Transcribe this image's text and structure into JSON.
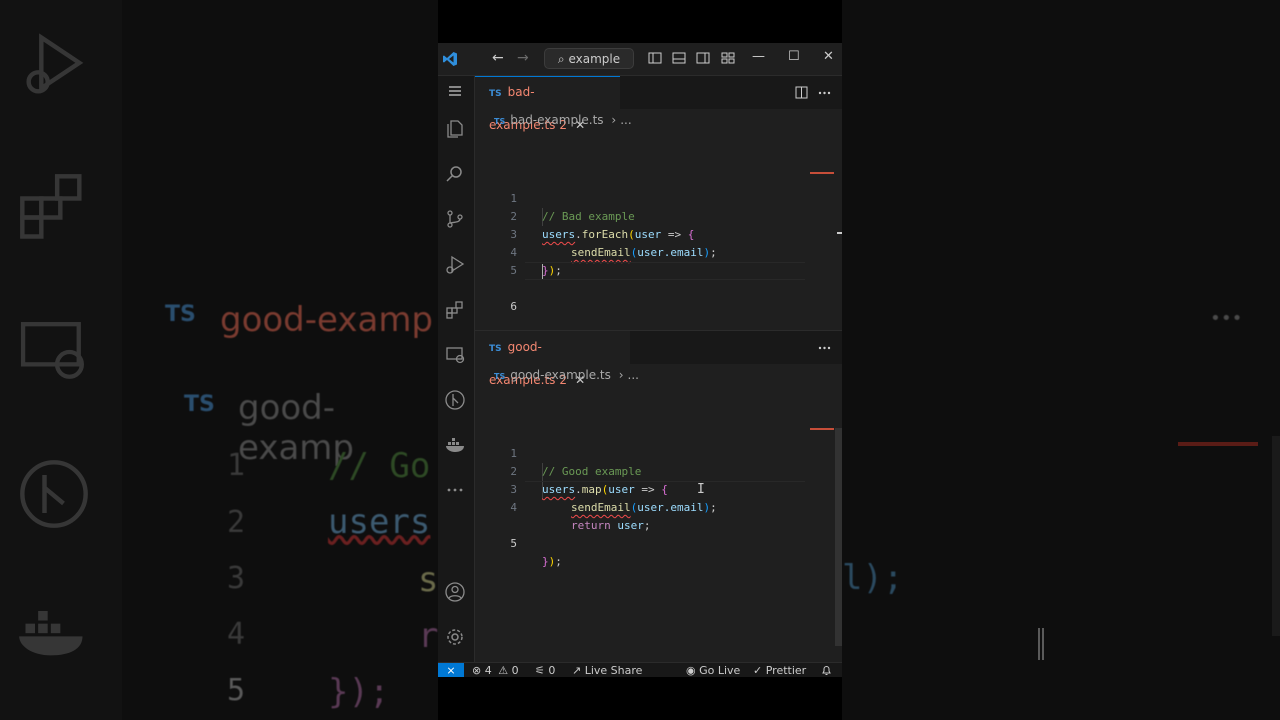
{
  "window": {
    "search_label": "example",
    "nav_back": "←",
    "nav_forward": "→",
    "min": "—",
    "max": "☐",
    "close": "✕"
  },
  "activity_icons": [
    "menu-icon",
    "explorer-icon",
    "search-icon",
    "source-control-icon",
    "run-debug-icon",
    "extensions-icon",
    "remote-explorer-icon",
    "git-graph-icon",
    "docker-icon",
    "more-icon",
    "accounts-icon",
    "settings-gear-icon"
  ],
  "editors": [
    {
      "tab_badge": "TS",
      "tab_filename": "bad-example.ts",
      "tab_problem_count": "2",
      "tab_close": "✕",
      "breadcrumb_file": "bad-example.ts",
      "breadcrumb_sep": "›",
      "breadcrumb_more": "...",
      "lines": [
        {
          "num": "1",
          "text": "// Bad example"
        },
        {
          "num": "2",
          "text": "users.forEach(user => {"
        },
        {
          "num": "3",
          "text": "    sendEmail(user.email);"
        },
        {
          "num": "4",
          "text": "});"
        },
        {
          "num": "5",
          "text": ""
        },
        {
          "num": "6",
          "text": ""
        }
      ],
      "active_line": "6"
    },
    {
      "tab_badge": "TS",
      "tab_filename": "good-example.ts",
      "tab_problem_count": "2",
      "tab_close": "✕",
      "breadcrumb_file": "good-example.ts",
      "breadcrumb_sep": "›",
      "breadcrumb_more": "...",
      "lines": [
        {
          "num": "1",
          "text": "// Good example"
        },
        {
          "num": "2",
          "text": "users.map(user => {"
        },
        {
          "num": "3",
          "text": "    sendEmail(user.email);"
        },
        {
          "num": "4",
          "text": "    return user;"
        },
        {
          "num": "5",
          "text": "});"
        }
      ],
      "active_line": "5"
    }
  ],
  "code_tokens": {
    "e1_l1": "// Bad example",
    "e1_l2_users": "users",
    "e1_l2_dot": ".",
    "e1_l2_fn": "forEach",
    "e1_l2_open": "(",
    "e1_l2_param": "user",
    "e1_l2_arrow": " => ",
    "e1_l2_brace": "{",
    "e1_l3_fn": "sendEmail",
    "e1_l3_open": "(",
    "e1_l3_arg": "user.email",
    "e1_l3_close": ")",
    "e1_l3_semi": ";",
    "e1_l4_brace": "}",
    "e1_l4_paren": ")",
    "e1_l4_semi": ";",
    "e2_l1": "// Good example",
    "e2_l2_users": "users",
    "e2_l2_dot": ".",
    "e2_l2_fn": "map",
    "e2_l2_open": "(",
    "e2_l2_param": "user",
    "e2_l2_arrow": " => ",
    "e2_l2_brace": "{",
    "e2_l3_fn": "sendEmail",
    "e2_l3_open": "(",
    "e2_l3_arg": "user.email",
    "e2_l3_close": ")",
    "e2_l3_semi": ";",
    "e2_l4_kw": "return",
    "e2_l4_var": " user",
    "e2_l4_semi": ";",
    "e2_l5_brace": "}",
    "e2_l5_paren": ")",
    "e2_l5_semi": ";"
  },
  "statusbar": {
    "remote_icon": "⨯",
    "errors": "4",
    "warnings": "0",
    "ports": "0",
    "live_share": "Live Share",
    "go_live": "Go Live",
    "prettier": "Prettier"
  },
  "background": {
    "left_ts_1": "TS",
    "left_tab_1": "good-examp",
    "left_ts_2": "TS",
    "left_breadcrumb": "good-examp",
    "left_nums": [
      "1",
      "2",
      "3",
      "4",
      "5"
    ],
    "left_code_1": "// Go",
    "left_code_2": "users",
    "left_code_3": "s",
    "left_code_4": "r",
    "left_code_5": "});",
    "right_code": "l);",
    "right_dots": "•••"
  },
  "colors": {
    "accent": "#0078d4",
    "error": "#f48771",
    "comment": "#6a9955",
    "variable": "#9cdcfe",
    "function": "#dcdcaa",
    "keyword": "#c586c0"
  }
}
